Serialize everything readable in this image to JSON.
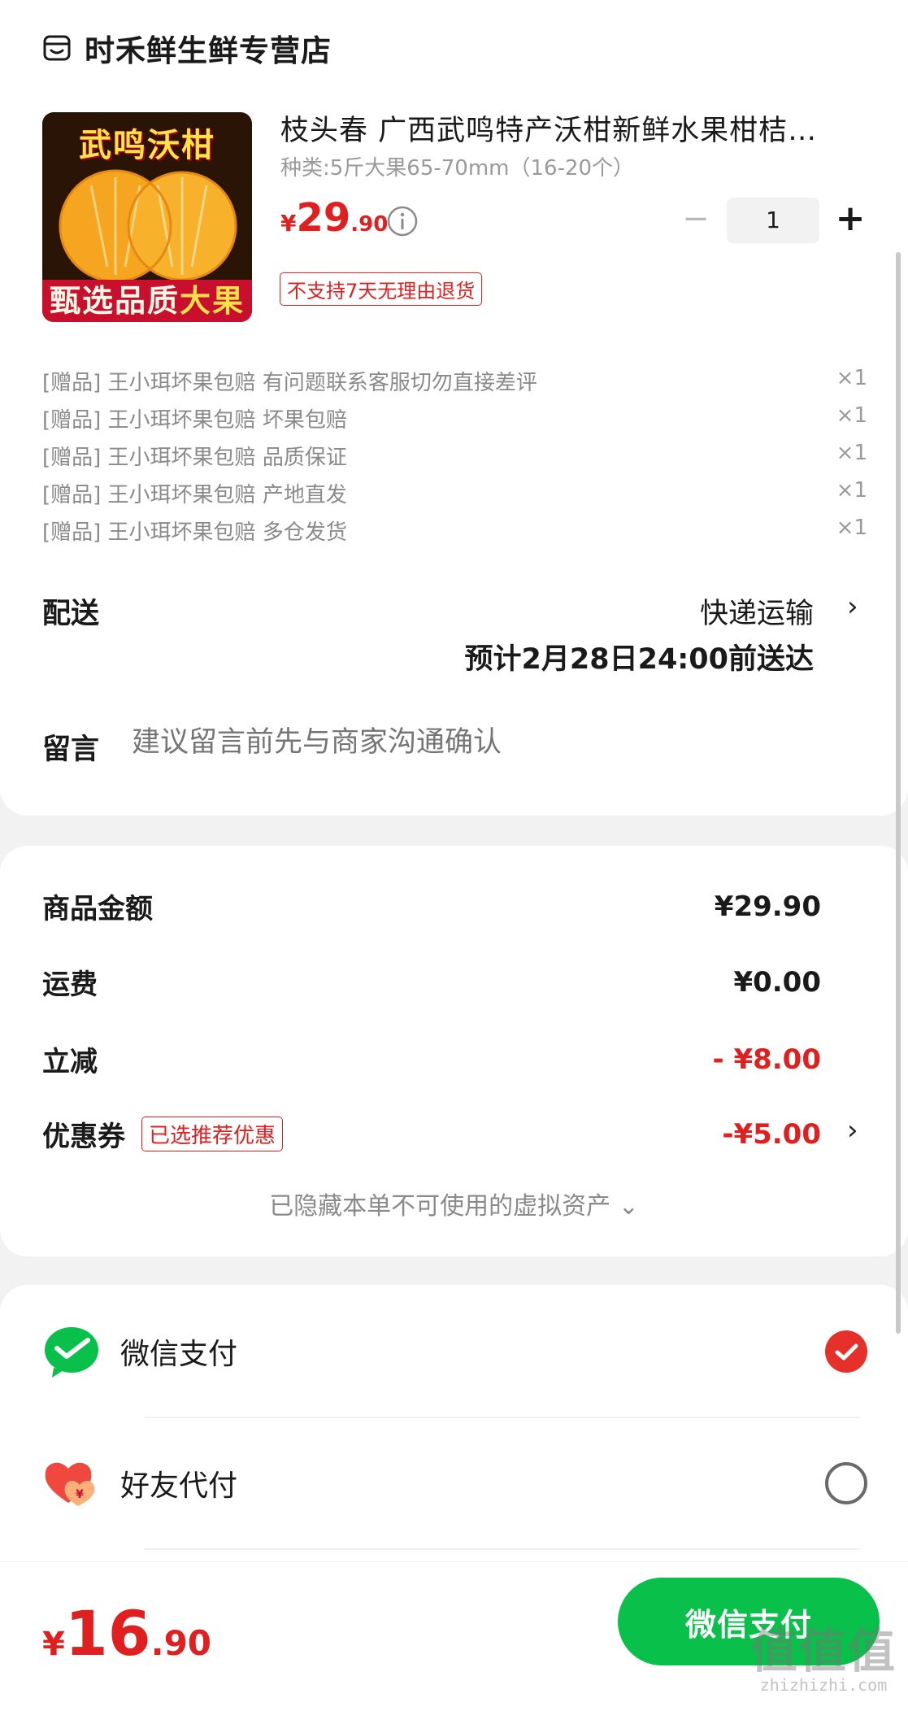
{
  "shop": {
    "name": "时禾鲜生鲜专营店",
    "icon": "store-icon"
  },
  "product": {
    "image_title": "武鸣沃柑",
    "image_banner_a": "甄选品质",
    "image_banner_b": "大果",
    "title": "枝头春 广西武鸣特产沃柑新鲜水果柑桔…",
    "spec": "种类:5斤大果65-70mm（16-20个）",
    "price_symbol": "¥",
    "price_int": "29",
    "price_dec": ".90",
    "quantity": "1",
    "minus": "−",
    "plus": "+",
    "return_policy": "不支持7天无理由退货"
  },
  "gifts": [
    {
      "label": "[赠品] 王小珥坏果包赔 有问题联系客服切勿直接差评",
      "qty": "×1"
    },
    {
      "label": "[赠品] 王小珥坏果包赔 坏果包赔",
      "qty": "×1"
    },
    {
      "label": "[赠品] 王小珥坏果包赔 品质保证",
      "qty": "×1"
    },
    {
      "label": "[赠品] 王小珥坏果包赔 产地直发",
      "qty": "×1"
    },
    {
      "label": "[赠品] 王小珥坏果包赔 多仓发货",
      "qty": "×1"
    }
  ],
  "shipping": {
    "label": "配送",
    "method": "快递运输",
    "eta": "预计2月28日24:00前送达"
  },
  "message": {
    "label": "留言",
    "placeholder": "建议留言前先与商家沟通确认"
  },
  "summary": {
    "goods_label": "商品金额",
    "goods_value": "¥29.90",
    "freight_label": "运费",
    "freight_value": "¥0.00",
    "discount_label": "立减",
    "discount_value": "- ¥8.00",
    "coupon_label": "优惠券",
    "coupon_tag": "已选推荐优惠",
    "coupon_value": "-¥5.00",
    "hidden_assets": "已隐藏本单不可使用的虚拟资产 ⌄"
  },
  "payment": {
    "wechat_label": "微信支付",
    "friend_label": "好友代付",
    "selected": "wechat"
  },
  "bottom": {
    "total_symbol": "¥",
    "total_int": "16",
    "total_dec": ".90",
    "pay_button": "微信支付"
  },
  "watermark": {
    "logo": "值值值",
    "url": "zhizhizhi.com"
  },
  "colors": {
    "accent_red": "#e02020",
    "wechat_green": "#09c04a",
    "radio_red": "#e6312a"
  }
}
